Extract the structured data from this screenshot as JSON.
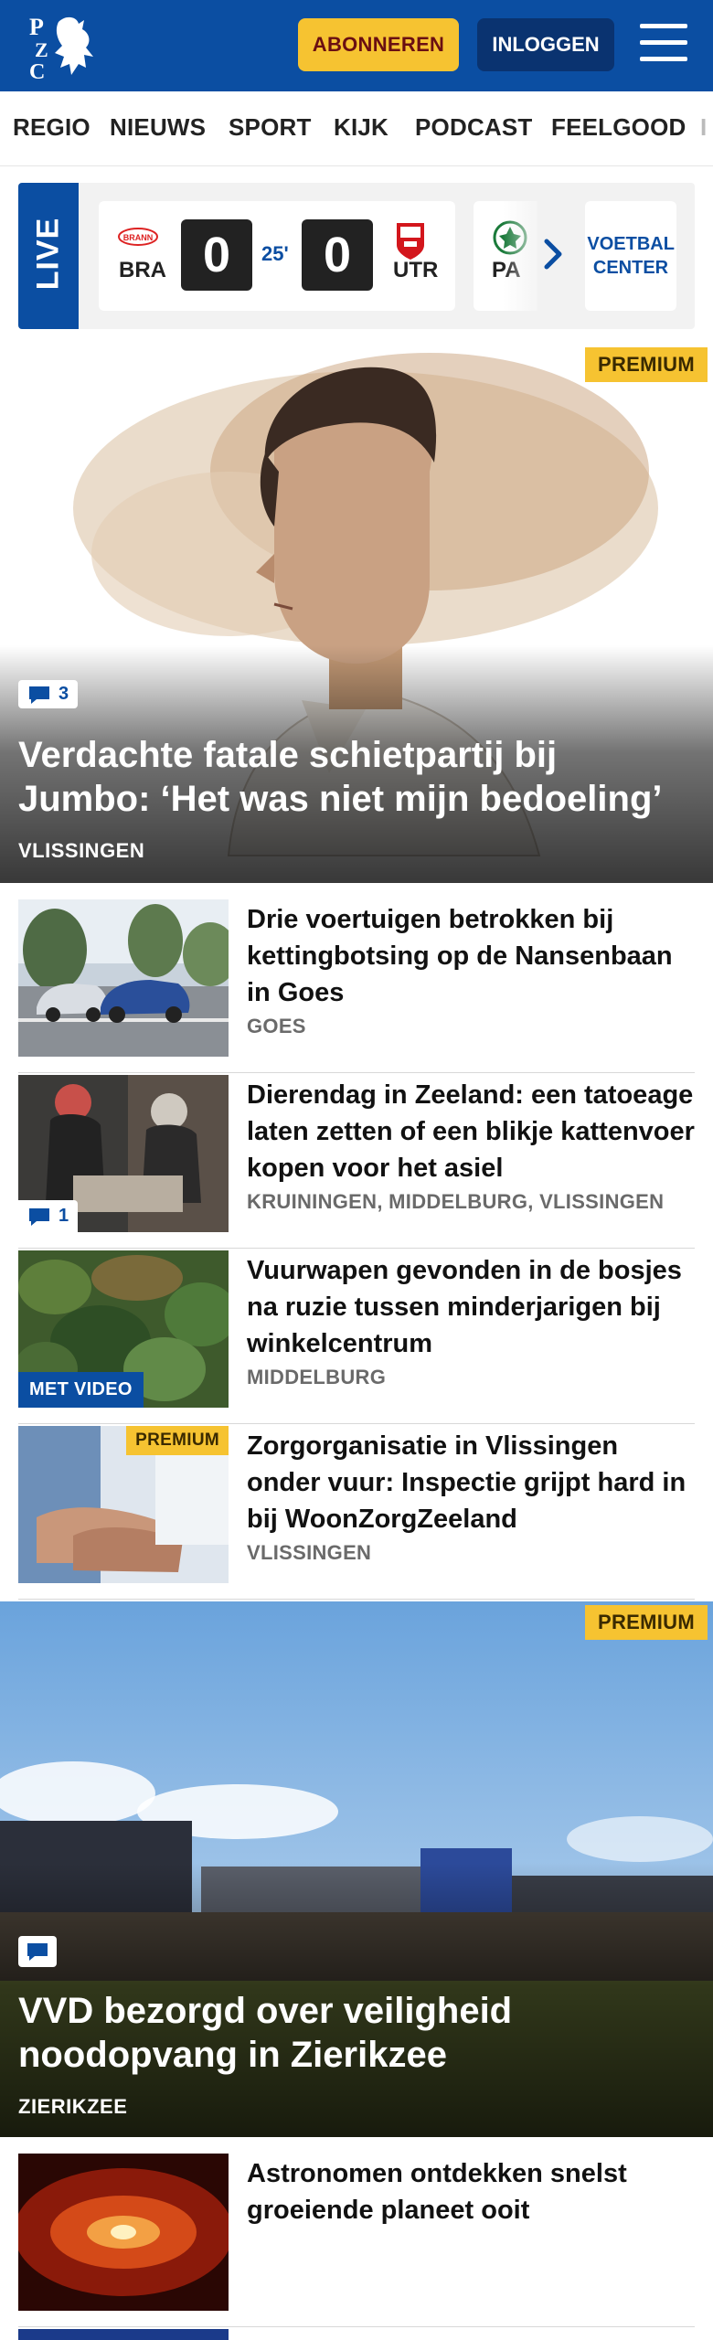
{
  "header": {
    "logo_letters": [
      "P",
      "Z",
      "C"
    ],
    "subscribe_label": "ABONNEREN",
    "login_label": "INLOGGEN",
    "menu_icon": "hamburger-menu-icon",
    "brand_color": "#0b4ea2",
    "accent_color": "#f6c331"
  },
  "nav": {
    "items": [
      "REGIO",
      "NIEUWS",
      "SPORT",
      "KIJK",
      "PODCAST",
      "FEELGOOD",
      "I"
    ]
  },
  "live": {
    "badge": "LIVE",
    "match": {
      "home_team": "BRA",
      "home_logo_text": "BRANN",
      "home_score": "0",
      "minute": "25'",
      "away_score": "0",
      "away_team": "UTR"
    },
    "next_team": "PA",
    "voetbal_center_label": "VOETBAL CENTER"
  },
  "hero_articles": [
    {
      "premium_label": "PREMIUM",
      "comments": "3",
      "title": "Verdachte fatale schietpartij bij Jumbo: ‘Het was niet mijn bedoeling’",
      "location": "VLISSINGEN"
    },
    {
      "premium_label": "PREMIUM",
      "comments": "",
      "title": "VVD bezorgd over veiligheid noodopvang in Zierikzee",
      "location": "ZIERIKZEE"
    }
  ],
  "articles": [
    {
      "title": "Drie voertuigen betrokken bij kettingbotsing op de Nansenbaan in Goes",
      "location": "GOES"
    },
    {
      "title": "Dierendag in Zeeland: een tatoeage laten zetten of een blikje kattenvoer kopen voor het asiel",
      "location": "KRUININGEN, MIDDELBURG, VLISSINGEN",
      "comments": "1"
    },
    {
      "title": "Vuurwapen gevonden in de bosjes na ruzie tussen minderjarigen bij winkelcentrum",
      "location": "MIDDELBURG",
      "video_label": "MET VIDEO"
    },
    {
      "title": "Zorgorganisatie in Vlissingen onder vuur: Inspectie grijpt hard in bij WoonZorgZeeland",
      "location": "VLISSINGEN",
      "premium_label": "PREMIUM"
    },
    {
      "title": "Astronomen ontdekken snelst groeiende planeet ooit",
      "location": ""
    }
  ]
}
